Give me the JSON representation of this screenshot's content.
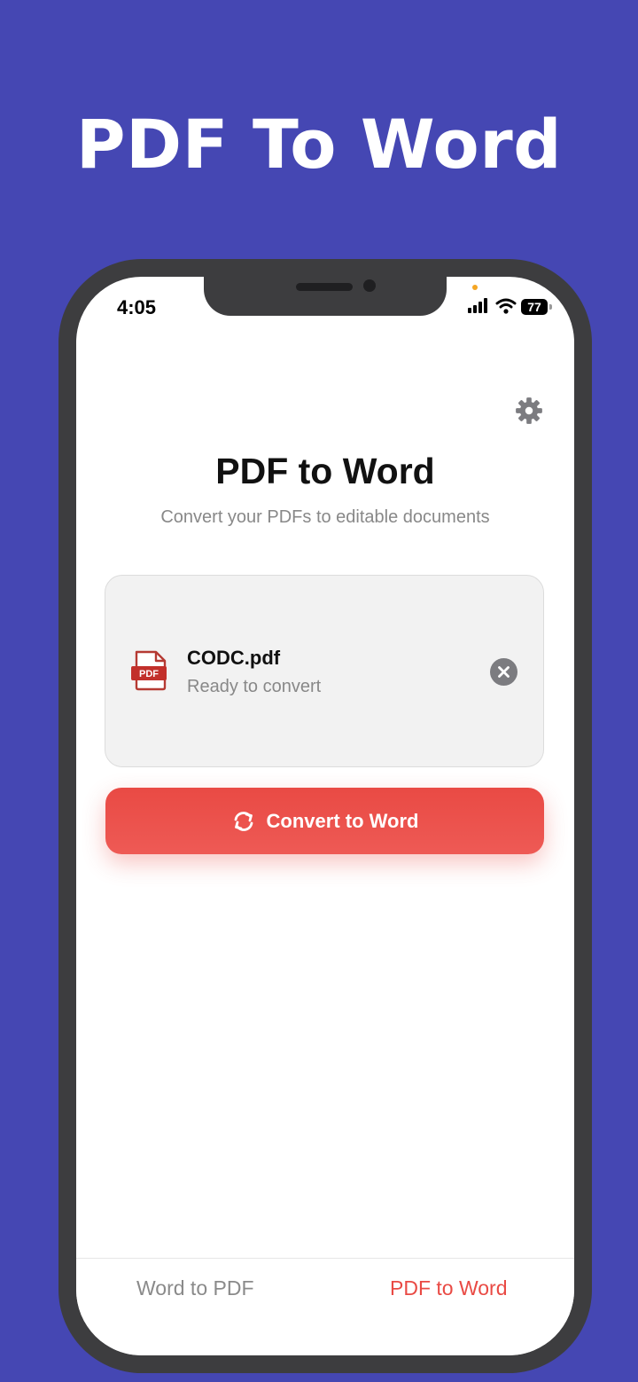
{
  "promo": {
    "title": "PDF To Word"
  },
  "status_bar": {
    "time": "4:05",
    "battery": "77"
  },
  "header": {
    "title": "PDF to Word",
    "subtitle": "Convert your PDFs to editable documents",
    "settings_icon": "gear-icon"
  },
  "file": {
    "icon_label": "PDF",
    "name": "CODC.pdf",
    "status": "Ready to convert",
    "remove_icon": "close-circle-icon"
  },
  "convert_button": {
    "label": "Convert to Word",
    "icon": "refresh-icon"
  },
  "tabs": [
    {
      "label": "Word to PDF",
      "active": false
    },
    {
      "label": "PDF to Word",
      "active": true
    }
  ],
  "colors": {
    "background": "#4547b3",
    "accent": "#e94a44",
    "frame": "#3d3d3f",
    "card": "#f2f2f2",
    "muted_text": "#888888"
  }
}
